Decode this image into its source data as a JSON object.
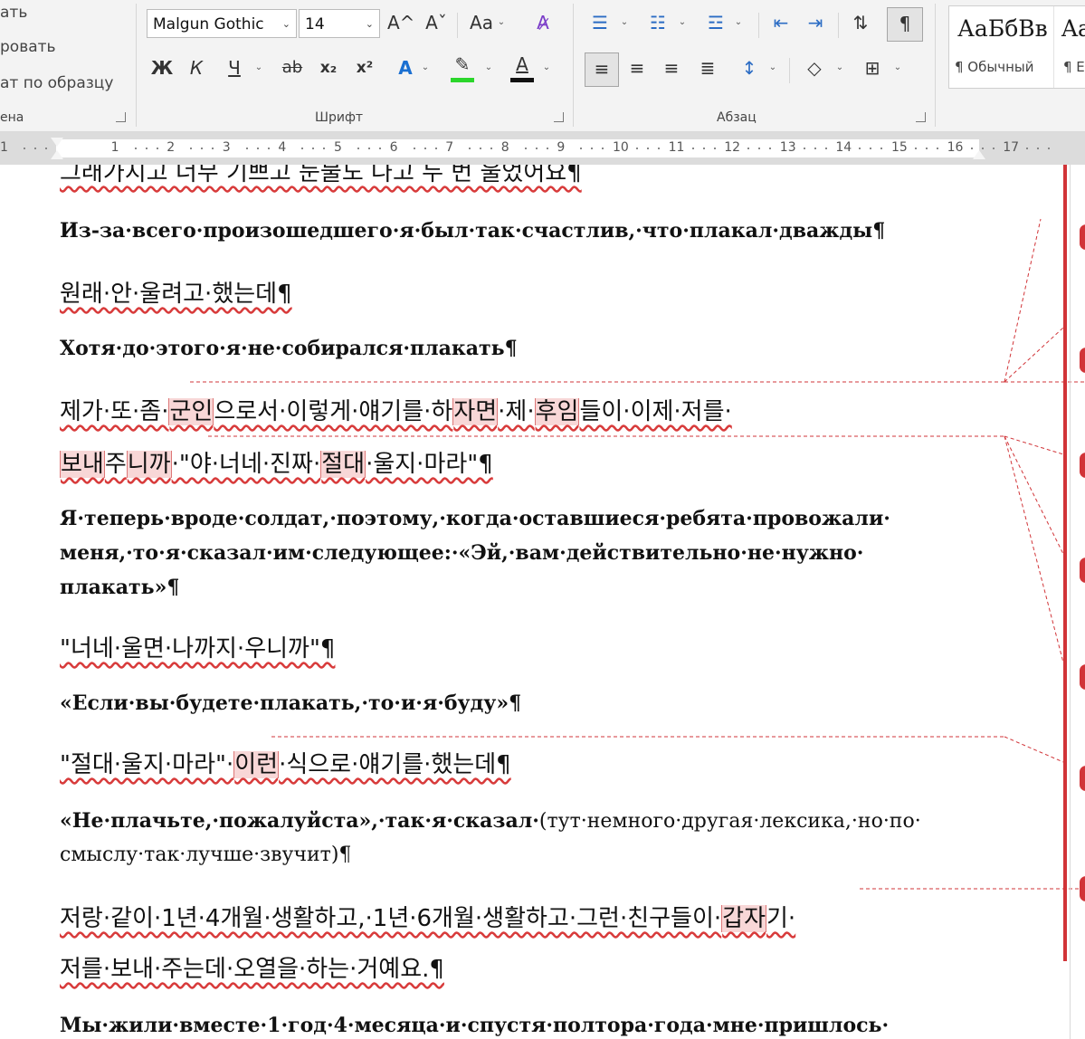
{
  "ribbon": {
    "clipboard": {
      "items": [
        "ать",
        "ровать",
        "ат по образцу"
      ],
      "label": "ена"
    },
    "font": {
      "family": "Malgun Gothic",
      "size": "14",
      "grow": "A^",
      "shrink": "Aˇ",
      "case": "Aa",
      "bold": "Ж",
      "italic": "К",
      "underline": "Ч",
      "strike": "ab",
      "sub": "x₂",
      "sup": "x²",
      "label": "Шрифт"
    },
    "paragraph": {
      "label": "Абзац",
      "pilcrow": "¶"
    },
    "styles": [
      {
        "sample": "АаБбВв",
        "name": "¶ Обычный"
      },
      {
        "sample": "Aa",
        "name": "¶ Е"
      }
    ],
    "colors": {
      "highlight": "#2bd62b",
      "font_color": "#111111",
      "accent": "#d13438"
    }
  },
  "ruler": {
    "numbers": [
      "1",
      "1",
      "2",
      "3",
      "4",
      "5",
      "6",
      "7",
      "8",
      "9",
      "10",
      "11",
      "12",
      "13",
      "14",
      "15",
      "16",
      "17"
    ]
  },
  "doc": {
    "top_partial": "그래가지고 너무 기쁘고 눈물도 나고 두 번 울었어요¶",
    "p1": "Из-за·всего·произошедшего·я·был·так·счастлив,·что·плакал·дважды¶",
    "p2": "원래·안·울려고·했는데¶",
    "p3": "Хотя·до·этого·я·не·собирался·плакать¶",
    "p4": {
      "a": "제가·또·좀·",
      "b": "군인",
      "c": "으로서·이렇게·얘기를·하",
      "d": "자면",
      "e": "·제·",
      "f": "후임",
      "g": "들이·이제·저를·"
    },
    "p4b": {
      "a": "보내",
      "b": "주",
      "c": "니까",
      "d": "·\"야·너네·진짜·",
      "e": "절대",
      "f": "·울지·마라\"¶"
    },
    "p5": [
      "Я·теперь·вроде·солдат,·поэтому,·когда·оставшиеся·ребята·провожали·",
      "меня,·то·я·сказал·им·следующее:·«Эй,·вам·действительно·не·нужно·",
      "плакать»¶"
    ],
    "p6": "\"너네·울면·나까지·우니까\"¶",
    "p7": "«Если·вы·будете·плакать,·то·и·я·буду»¶",
    "p8": {
      "a": "\"절대·울지·마라\"·",
      "b": "이런",
      "c": "·식으로·얘기를·했는데¶"
    },
    "p9": {
      "a": "«Не·плачьте,·пожалуйста»,·так·я·сказал·",
      "b": "(тут·немного·другая·лексика,·но·по·",
      "c": "смыслу·так·лучше·звучит)¶"
    },
    "p10": {
      "a": "저랑·같이·1년·4개월·생활하고,·1년·6개월·생활하고·그런·친구들이·",
      "b": "갑자",
      "c": "기·"
    },
    "p10b": "저를·보내·주는데·오열을·하는·거예요.¶",
    "p11": "Мы·жили·вместе·1·год·4·месяца·и·спустя·полтора·года·мне·пришлось·"
  }
}
